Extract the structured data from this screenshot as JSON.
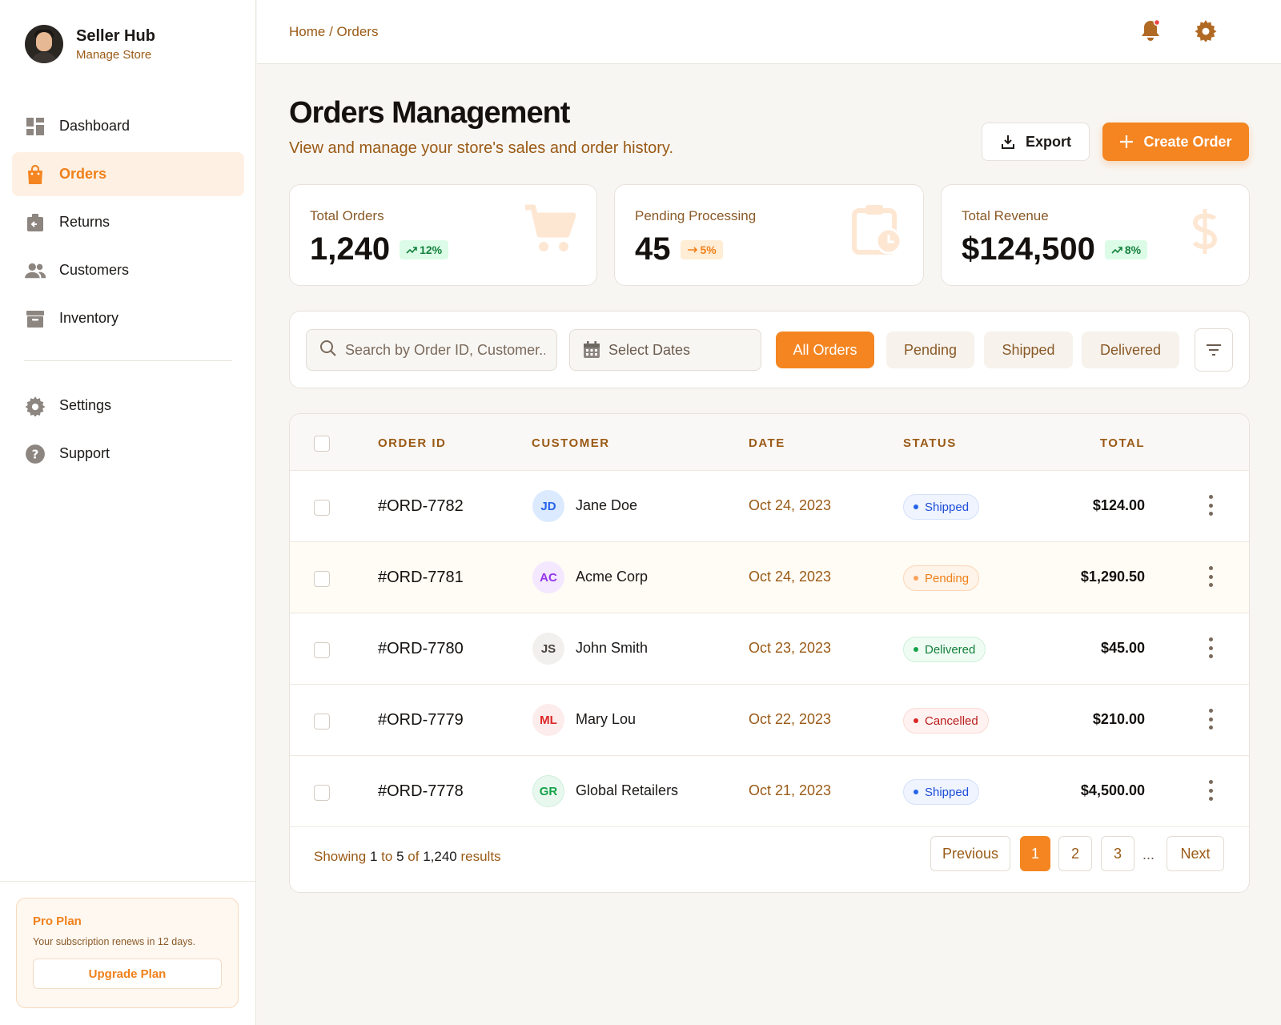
{
  "brand": {
    "title": "Seller Hub",
    "subtitle": "Manage Store"
  },
  "sidebar": {
    "items": [
      {
        "label": "Dashboard",
        "icon": "dashboard-icon",
        "active": false
      },
      {
        "label": "Orders",
        "icon": "shopping-bag-icon",
        "active": true
      },
      {
        "label": "Returns",
        "icon": "returns-icon",
        "active": false
      },
      {
        "label": "Customers",
        "icon": "users-icon",
        "active": false
      },
      {
        "label": "Inventory",
        "icon": "archive-icon",
        "active": false
      }
    ],
    "secondary": [
      {
        "label": "Settings",
        "icon": "gear-icon"
      },
      {
        "label": "Support",
        "icon": "help-icon"
      }
    ],
    "plan": {
      "title": "Pro Plan",
      "description": "Your subscription renews in 12 days.",
      "button": "Upgrade Plan"
    }
  },
  "header": {
    "breadcrumb": "Home / Orders"
  },
  "page": {
    "title": "Orders Management",
    "subtitle": "View and manage your store's sales and order history.",
    "export_label": "Export",
    "create_label": "Create Order"
  },
  "stats": [
    {
      "label": "Total Orders",
      "value": "1,240",
      "change": "12%",
      "trend": "up",
      "icon": "cart-icon"
    },
    {
      "label": "Pending Processing",
      "value": "45",
      "change": "5%",
      "trend": "flat",
      "icon": "clipboard-clock-icon"
    },
    {
      "label": "Total Revenue",
      "value": "$124,500",
      "change": "8%",
      "trend": "up",
      "icon": "dollar-icon"
    }
  ],
  "filters": {
    "search_placeholder": "Search by Order ID, Customer...",
    "date_placeholder": "Select Dates",
    "tabs": [
      "All Orders",
      "Pending",
      "Shipped",
      "Delivered"
    ],
    "active_tab": 0
  },
  "table": {
    "columns": [
      "ORDER ID",
      "CUSTOMER",
      "DATE",
      "STATUS",
      "TOTAL"
    ],
    "rows": [
      {
        "id": "#ORD-7782",
        "initials": "JD",
        "customer": "Jane Doe",
        "date": "Oct 24, 2023",
        "status": "Shipped",
        "total": "$124.00"
      },
      {
        "id": "#ORD-7781",
        "initials": "AC",
        "customer": "Acme Corp",
        "date": "Oct 24, 2023",
        "status": "Pending",
        "total": "$1,290.50"
      },
      {
        "id": "#ORD-7780",
        "initials": "JS",
        "customer": "John Smith",
        "date": "Oct 23, 2023",
        "status": "Delivered",
        "total": "$45.00"
      },
      {
        "id": "#ORD-7779",
        "initials": "ML",
        "customer": "Mary Lou",
        "date": "Oct 22, 2023",
        "status": "Cancelled",
        "total": "$210.00"
      },
      {
        "id": "#ORD-7778",
        "initials": "GR",
        "customer": "Global Retailers",
        "date": "Oct 21, 2023",
        "status": "Shipped",
        "total": "$4,500.00"
      }
    ]
  },
  "pagination": {
    "showing_prefix": "Showing",
    "from": "1",
    "to_word": "to",
    "to": "5",
    "of_word": "of",
    "total": "1,240",
    "suffix": "results",
    "previous": "Previous",
    "next": "Next",
    "pages": [
      "1",
      "2",
      "3"
    ],
    "ellipsis": "...",
    "current": "1"
  },
  "colors": {
    "accent": "#f48521",
    "brown": "#9a5a16",
    "shipped": "#2563eb",
    "pending": "#f0801a",
    "delivered": "#15803d",
    "cancelled": "#dc2626"
  }
}
